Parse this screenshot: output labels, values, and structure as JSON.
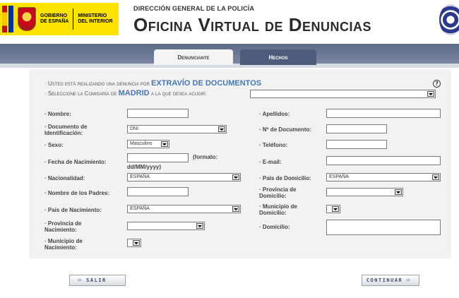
{
  "header": {
    "gov_line1": "GOBIERNO",
    "gov_line2": "DE ESPAÑA",
    "ministry_line1": "MINISTERIO",
    "ministry_line2": "DEL INTERIOR",
    "subtitle": "DIRECCIÓN GENERAL DE LA POLICÍA",
    "title": "Oficina Virtual de Denuncias"
  },
  "tabs": {
    "active": "Denunciante",
    "inactive": "Hechos"
  },
  "notes": {
    "line1_prefix": "· Usted está realizando una denuncia por",
    "line1_highlight": "EXTRAVÍO DE DOCUMENTOS",
    "line2_prefix": "· Seleccione la Comisaría de",
    "line2_highlight": "MADRID",
    "line2_suffix": "a la que desea acudir:",
    "help": "?"
  },
  "form": {
    "nombre": "· Nombre:",
    "apellidos": "· Apellidos:",
    "documento_line1": "· Documento de",
    "documento_line2": "Identificación:",
    "documento_value": "DNI",
    "num_documento": "· Nº de Documento:",
    "sexo": "· Sexo:",
    "sexo_value": "Masculino",
    "telefono": "· Teléfono:",
    "fecha": "· Fecha de Nacimiento:",
    "fecha_fmt_line1": "(formato:",
    "fecha_fmt_line2": "dd/MM/yyyy)",
    "email": "· E-mail:",
    "nacionalidad": "· Nacionalidad:",
    "nacionalidad_value": "ESPAÑA",
    "pais_domicilio": "· País de Domicilio:",
    "pais_domicilio_value": "ESPAÑA",
    "padres": "· Nombre de los Padres:",
    "prov_domicilio_line1": "· Provincia de",
    "prov_domicilio_line2": "Domicilio:",
    "pais_nacimiento": "· País de Nacimiento:",
    "pais_nacimiento_value": "ESPAÑA",
    "mun_domicilio_line1": "· Municipio de",
    "mun_domicilio_line2": "Domicilio:",
    "prov_nacimiento_line1": "· Provincia de",
    "prov_nacimiento_line2": "Nacimiento:",
    "domicilio": "· Domicilio:",
    "mun_nacimiento_line1": "· Municipio de",
    "mun_nacimiento_line2": "Nacimiento:"
  },
  "buttons": {
    "exit": "SALIR",
    "continue": "CONTINUAR"
  },
  "icons": {
    "exit": "arrow-left-icon",
    "continue": "arrow-right-icon"
  },
  "colors": {
    "accent": "#4777b2",
    "tabbar": "#5c6a86",
    "panel": "#f2f2f2"
  }
}
